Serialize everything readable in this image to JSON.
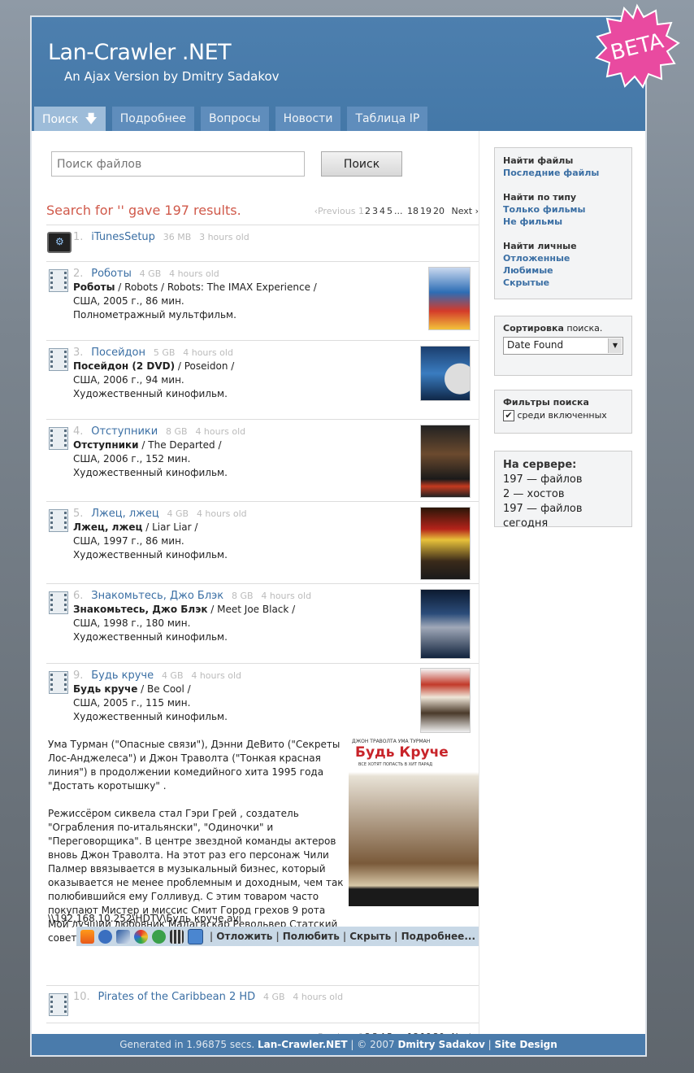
{
  "header": {
    "title": "Lan-Crawler .NET",
    "subtitle": "An Ajax Version by Dmitry Sadakov",
    "badge": "BETA"
  },
  "nav": [
    {
      "label": "Поиск",
      "active": true
    },
    {
      "label": "Подробнее"
    },
    {
      "label": "Вопросы"
    },
    {
      "label": "Новости"
    },
    {
      "label": "Таблица IP"
    }
  ],
  "search": {
    "placeholder": "Поиск файлов",
    "button": "Поиск",
    "result_message": "Search for '' gave 197 results."
  },
  "pager": {
    "prev": "‹Previous",
    "current": "1",
    "pages": [
      "2",
      "3",
      "4",
      "5"
    ],
    "ellipsis": "...",
    "later": [
      "18",
      "19",
      "20"
    ],
    "next": "Next ›"
  },
  "results": [
    {
      "num": "1.",
      "title": "iTunesSetup",
      "size": "36 MB",
      "age": "3 hours old",
      "icon": "app-icon"
    },
    {
      "num": "2.",
      "title": "Роботы",
      "size": "4 GB",
      "age": "4 hours old",
      "bold": "Роботы",
      "alt": " / Robots / Robots: The IMAX Experience /",
      "info": "США, 2005 г., 86 мин.",
      "genre": "Полнометражный мультфильм."
    },
    {
      "num": "3.",
      "title": "Посейдон",
      "size": "5 GB",
      "age": "4 hours old",
      "bold": "Посейдон (2 DVD)",
      "alt": " / Poseidon /",
      "info": "США, 2006 г., 94 мин.",
      "genre": "Художественный кинофильм."
    },
    {
      "num": "4.",
      "title": "Отступники",
      "size": "8 GB",
      "age": "4 hours old",
      "bold": "Отступники",
      "alt": " / The Departed /",
      "info": "США, 2006 г., 152 мин.",
      "genre": "Художественный кинофильм."
    },
    {
      "num": "5.",
      "title": "Лжец, лжец",
      "size": "4 GB",
      "age": "4 hours old",
      "bold": "Лжец, лжец",
      "alt": " / Liar Liar /",
      "info": "США, 1997 г., 86 мин.",
      "genre": "Художественный кинофильм."
    },
    {
      "num": "6.",
      "title": "Знакомьтесь, Джо Блэк",
      "size": "8 GB",
      "age": "4 hours old",
      "bold": "Знакомьтесь, Джо Блэк",
      "alt": " / Meet Joe Black /",
      "info": "США, 1998 г., 180 мин.",
      "genre": "Художественный кинофильм."
    },
    {
      "num": "9.",
      "title": "Будь круче",
      "size": "4 GB",
      "age": "4 hours old",
      "bold": "Будь круче",
      "alt": " / Be Cool /",
      "info": "США, 2005 г., 115 мин.",
      "genre": "Художественный кинофильм."
    },
    {
      "num": "10.",
      "title": "Pirates of the Caribbean 2 HD",
      "size": "4 GB",
      "age": "4 hours old"
    }
  ],
  "expanded": {
    "p1": "Ума Турман (\"Опасные связи\"), Дэнни ДеВито (\"Секреты Лос-Анджелеса\") и Джон Траволта (\"Тонкая красная линия\") в продолжении комедийного хита 1995 года \"Достать коротышку\" .",
    "p2": "Режиссёром сиквела стал Гэри Грей , создатель \"Ограбления по-итальянски\", \"Одиночки\" и \"Переговорщика\". В центре звездной команды актеров вновь Джон Траволта. На этот раз его персонаж Чили Палмер ввязывается в музыкальный бизнес, который оказывается не менее проблемным и доходным, чем так полюбившийся ему Голливуд. С этим товаром часто покупают Мистер и миссис Смит Город грехов 9 рота Мой лучший любовник Мадагаскар Револьвер Статский советник Колдунья",
    "path": "\\\\192.168.10.252\\HDTV\\Будь круче.avi",
    "actions": [
      "Отложить",
      "Полюбить",
      "Скрыть",
      "Подробнее..."
    ],
    "poster_top_text": "ДЖОН ТРАВОЛТА   УМА ТУРМАН",
    "poster_title": "Будь Круче",
    "poster_tagline": "ВСЕ ХОТЯТ ПОПАСТЬ В ХИТ ПАРАД"
  },
  "sidebar": {
    "find": {
      "heading": "Найти файлы",
      "link": "Последние файлы"
    },
    "bytype": {
      "heading": "Найти по типу",
      "links": [
        "Только фильмы",
        "Не фильмы"
      ]
    },
    "personal": {
      "heading": "Найти личные",
      "links": [
        "Отложенные",
        "Любимые",
        "Скрытые"
      ]
    },
    "sort": {
      "heading_bold": "Сортировка",
      "heading_rest": " поиска.",
      "value": "Date Found"
    },
    "filters": {
      "heading": "Фильтры поиска",
      "checkbox_label": "среди включенных",
      "checked": true
    },
    "server": {
      "heading": "На сервере:",
      "lines": [
        "197 — файлов",
        "2 — хостов",
        "197 — файлов сегодня"
      ]
    }
  },
  "footer": {
    "generated": "Generated in 1.96875 secs.",
    "brand": "Lan-Crawler.NET",
    "copy": " | © 2007 ",
    "author": "Dmitry Sadakov",
    "sep": " | ",
    "design": "Site Design"
  },
  "colors": {
    "header": "#4a7bab",
    "link": "#3b6fa4",
    "result_msg": "#d0594a",
    "beta": "#e94aa0"
  }
}
